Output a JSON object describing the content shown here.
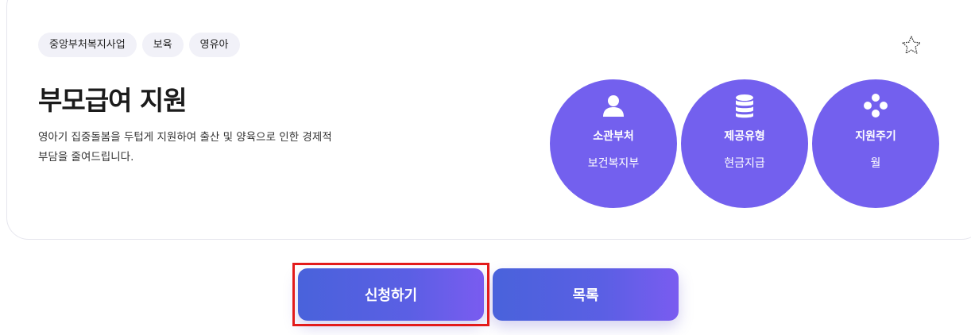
{
  "tags": [
    "중앙부처복지사업",
    "보육",
    "영유아"
  ],
  "title": "부모급여 지원",
  "description": "영아기 집중돌봄을 두텁게 지원하여 출산 및 양육으로 인한 경제적 부담을 줄여드립니다.",
  "info": [
    {
      "label": "소관부처",
      "value": "보건복지부",
      "icon": "person-icon"
    },
    {
      "label": "제공유형",
      "value": "현금지급",
      "icon": "coin-stack-icon"
    },
    {
      "label": "지원주기",
      "value": "월",
      "icon": "diamond-dots-icon"
    }
  ],
  "buttons": {
    "apply": "신청하기",
    "list": "목록"
  },
  "favorite_icon": "star-outline-icon",
  "colors": {
    "accent": "#7360ee",
    "button_start": "#4962db",
    "button_end": "#7a5cf0",
    "tag_bg": "#f1f1f8",
    "highlight": "#e31b1b"
  }
}
